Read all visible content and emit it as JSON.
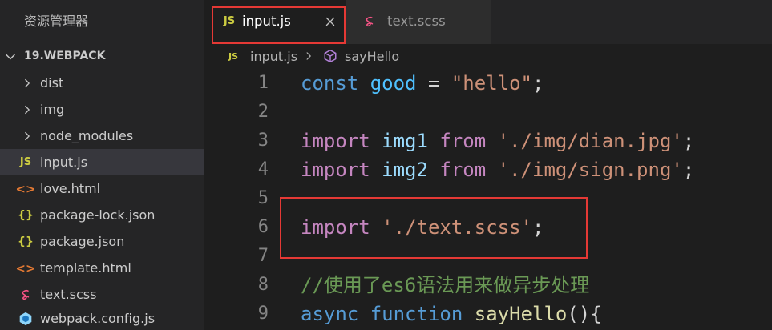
{
  "theme": {
    "editor_bg": "#1e1e1e",
    "sidebar_bg": "#252526",
    "sidebar_fg": "#cccccc",
    "sidebar_title_fg": "#bbbbbb",
    "selection_bg": "#37373d",
    "tab_active_bg": "#1e1e1e",
    "tab_inactive_bg": "#2d2d2d",
    "tab_active_fg": "#ffffff",
    "tab_inactive_fg": "#969696",
    "breadcrumb_fg": "#b4b4b4",
    "line_number_fg": "#858585",
    "icon_fg": "#c5c5c5",
    "js_icon": "#cbcb41",
    "html_icon": "#e37933",
    "json_icon": "#cbcb41",
    "sass_icon": "#f55385",
    "webpack_light": "#8ed6fb",
    "webpack_dark": "#1c78c0",
    "symbol_method": "#b180d7",
    "syntax_control": "#c586c0",
    "syntax_storage": "#569cd6",
    "syntax_constant": "#4fc1ff",
    "syntax_variable": "#9cdcfe",
    "syntax_string": "#ce9178",
    "syntax_punctuation": "#d4d4d4",
    "syntax_comment": "#6a9955",
    "syntax_function": "#dcdcaa",
    "annotation_red": "#e53935"
  },
  "sidebar": {
    "title": "资源管理器",
    "section": {
      "label": "19.WEBPACK",
      "expanded": true,
      "icon": "chevron-down-icon"
    },
    "items": [
      {
        "label": "dist",
        "is_folder": true,
        "expanded": false,
        "icon": "chevron-right-icon"
      },
      {
        "label": "img",
        "is_folder": true,
        "expanded": false,
        "icon": "chevron-right-icon"
      },
      {
        "label": "node_modules",
        "is_folder": true,
        "expanded": false,
        "icon": "chevron-right-icon"
      },
      {
        "label": "input.js",
        "is_folder": false,
        "icon": "js-icon",
        "icon_text": "JS",
        "selected": true
      },
      {
        "label": "love.html",
        "is_folder": false,
        "icon": "html-icon",
        "icon_text": "<>"
      },
      {
        "label": "package-lock.json",
        "is_folder": false,
        "icon": "json-icon",
        "icon_text": "{}"
      },
      {
        "label": "package.json",
        "is_folder": false,
        "icon": "json-icon",
        "icon_text": "{}"
      },
      {
        "label": "template.html",
        "is_folder": false,
        "icon": "html-icon",
        "icon_text": "<>"
      },
      {
        "label": "text.scss",
        "is_folder": false,
        "icon": "sass-icon"
      },
      {
        "label": "webpack.config.js",
        "is_folder": false,
        "icon": "webpack-icon"
      }
    ]
  },
  "tabs": [
    {
      "label": "input.js",
      "icon": "js-icon",
      "icon_text": "JS",
      "active": true,
      "close_icon": "close-icon"
    },
    {
      "label": "text.scss",
      "icon": "sass-icon",
      "active": false
    }
  ],
  "breadcrumb": {
    "file": {
      "label": "input.js",
      "icon": "js-icon",
      "icon_text": "JS"
    },
    "separator_icon": "chevron-right-icon",
    "symbol": {
      "label": "sayHello",
      "icon": "symbol-method-icon"
    }
  },
  "editor": {
    "lines": [
      {
        "number": 1,
        "tokens": [
          "const",
          " ",
          "good",
          " = ",
          "\"hello\"",
          ";"
        ]
      },
      {
        "number": 2,
        "tokens": []
      },
      {
        "number": 3,
        "tokens": [
          "import",
          " ",
          "img1",
          " ",
          "from",
          " ",
          "'./img/dian.jpg'",
          ";"
        ]
      },
      {
        "number": 4,
        "tokens": [
          "import",
          " ",
          "img2",
          " ",
          "from",
          " ",
          "'./img/sign.png'",
          ";"
        ]
      },
      {
        "number": 5,
        "tokens": []
      },
      {
        "number": 6,
        "tokens": [
          "import",
          " ",
          "'./text.scss'",
          ";"
        ]
      },
      {
        "number": 7,
        "tokens": []
      },
      {
        "number": 8,
        "tokens": [
          "//使用了es6语法用来做异步处理"
        ]
      },
      {
        "number": 9,
        "tokens": [
          "async",
          " ",
          "function",
          " ",
          "sayHello",
          "(){"
        ]
      }
    ]
  }
}
